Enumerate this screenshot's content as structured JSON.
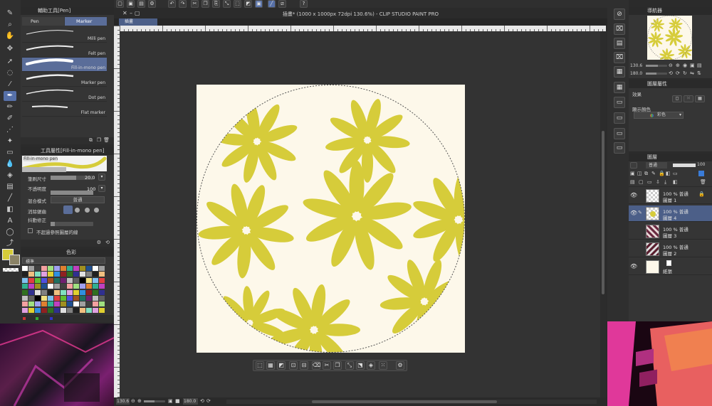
{
  "window": {
    "title": "插畫* (1000 x 1000px 72dpi 130.6%) - CLIP STUDIO PAINT PRO",
    "canvas_tab": "插畫"
  },
  "sub_tool_panel": {
    "title": "輔助工具[Pen]",
    "tabs": [
      {
        "label": "Pen"
      },
      {
        "label": "Marker"
      }
    ],
    "brushes": [
      {
        "label": "Milli pen"
      },
      {
        "label": "Felt pen"
      },
      {
        "label": "Fill-in-mono pen"
      },
      {
        "label": "Marker pen"
      },
      {
        "label": "Dot pen"
      },
      {
        "label": "Flat marker"
      }
    ]
  },
  "tool_property": {
    "title": "工具屬性[Fill-in-mono pen]",
    "preview_label": "Fill-in-mono pen",
    "brush_size_label": "筆刷尺寸",
    "brush_size_value": "20.0",
    "opacity_label": "不透明度",
    "opacity_value": "100",
    "blend_label": "混合模式",
    "blend_value": "普通",
    "antialias_label": "消除鋸齒",
    "stabilize_label": "抖動修正",
    "no_exceed_label": "不超過參照圖層的線"
  },
  "color_panel": {
    "tab_label": "色彩",
    "set_label": "標準",
    "main_color": "#d6cc3a",
    "sub_color": "#8a8266"
  },
  "navigator": {
    "title": "導航器",
    "zoom_value": "130.6",
    "angle_value": "180.0"
  },
  "layer_property": {
    "title": "圖層屬性",
    "effect_label": "效果",
    "display_color_label": "顯示顏色",
    "display_color_value": "彩色"
  },
  "layers_panel": {
    "title": "圖層",
    "blend_value": "普通",
    "opacity_value": "100",
    "layers": [
      {
        "percent": "100 %",
        "mode": "普通",
        "name": "圖層 1"
      },
      {
        "percent": "100 %",
        "mode": "普通",
        "name": "圖層 4"
      },
      {
        "percent": "100 %",
        "mode": "普通",
        "name": "圖層 3"
      },
      {
        "percent": "100 %",
        "mode": "普通",
        "name": "圖層 2"
      },
      {
        "percent": "",
        "mode": "",
        "name": "紙張"
      }
    ]
  },
  "status_bar": {
    "zoom": "130.6",
    "angle": "180.0"
  },
  "colors": {
    "accent": "#5670a8",
    "paper": "#fdf8ea",
    "flower": "#d6cc3a"
  }
}
